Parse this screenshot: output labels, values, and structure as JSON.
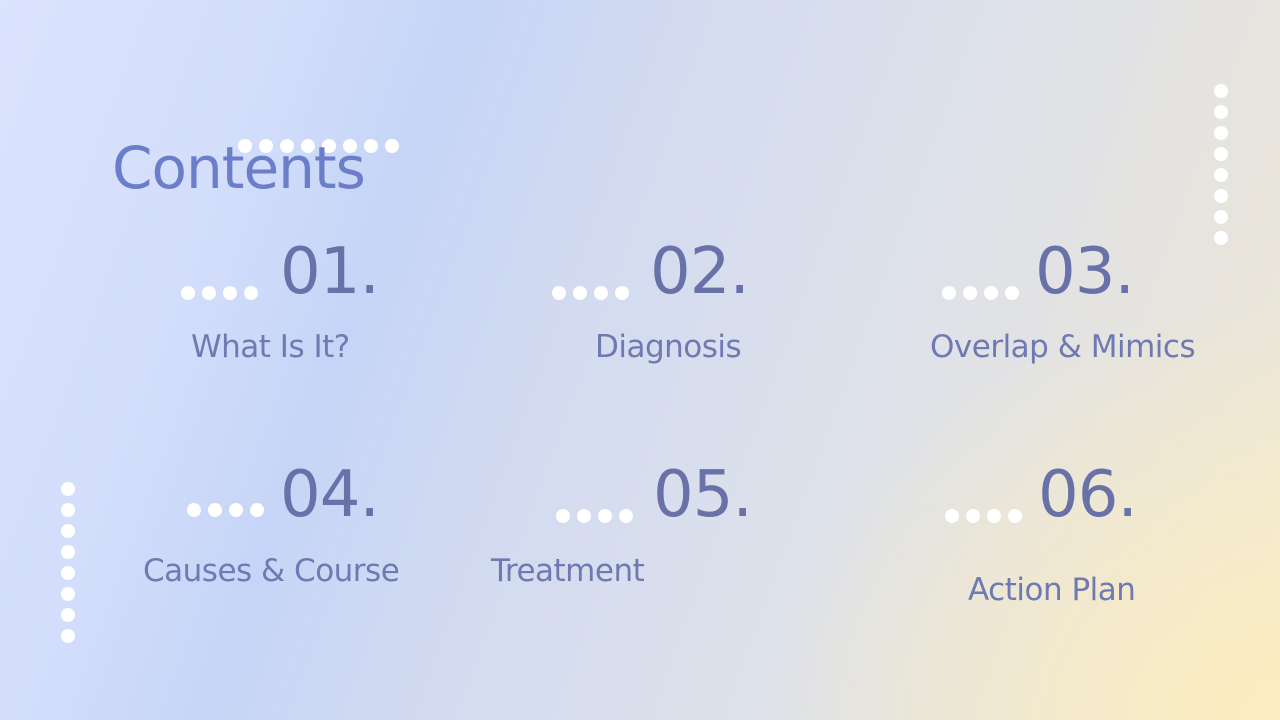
{
  "slide": {
    "title": "Contents",
    "items": [
      {
        "number": "01.",
        "label": "What Is It?"
      },
      {
        "number": "02.",
        "label": "Diagnosis"
      },
      {
        "number": "03.",
        "label": "Overlap & Mimics"
      },
      {
        "number": "04.",
        "label": "Causes & Course"
      },
      {
        "number": "05.",
        "label": "Treatment"
      },
      {
        "number": "06.",
        "label": "Action Plan"
      }
    ]
  },
  "colors": {
    "title": "#6b7ec9",
    "number": "#6872a8",
    "label": "#6f7ab3",
    "dots": "#ffffff"
  }
}
